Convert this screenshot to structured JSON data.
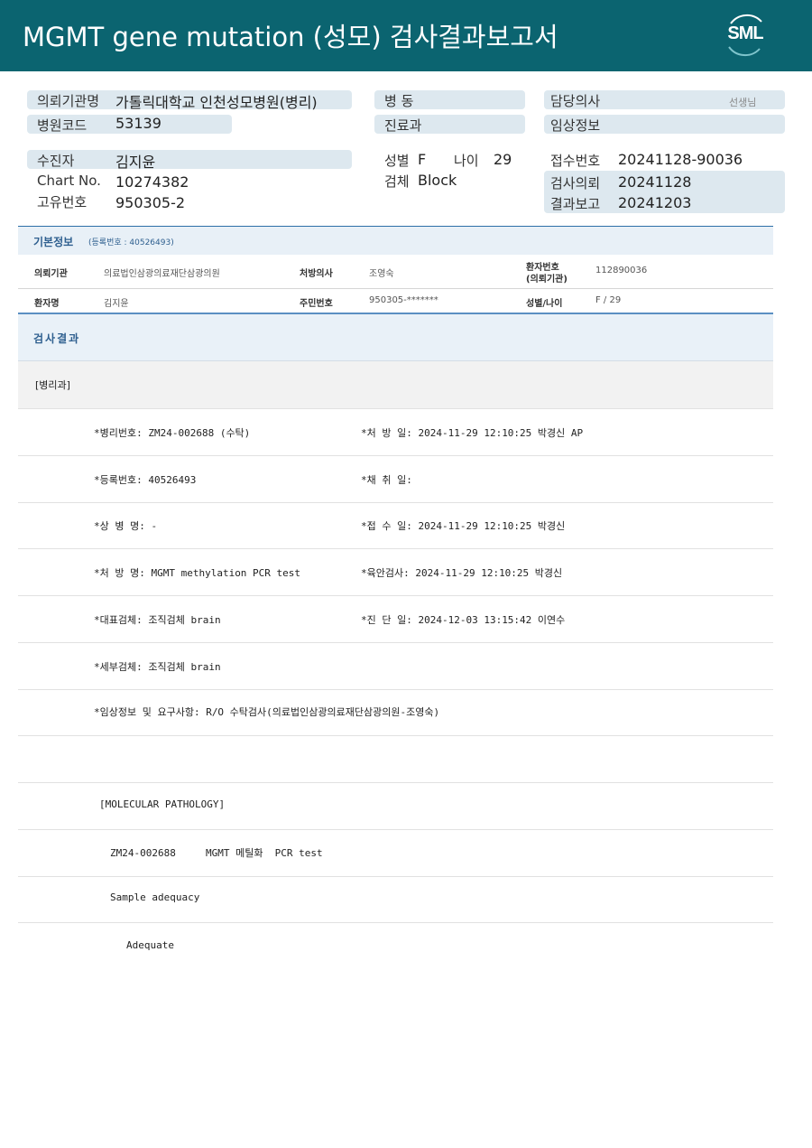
{
  "header": {
    "title": "MGMT gene mutation (성모) 검사결과보고서",
    "logo_text": "SML"
  },
  "top_info": {
    "hospital_label": "의뢰기관명",
    "hospital_value": "가톨릭대학교 인천성모병원(병리)",
    "code_label": "병원코드",
    "code_value": "53139",
    "ward_label": "병  동",
    "dept_label": "진료과",
    "doctor_label": "담당의사",
    "doctor_suffix": "선생님",
    "clinical_label": "임상정보",
    "patient_label": "수진자",
    "patient_value": "김지윤",
    "chart_label": "Chart No.",
    "chart_value": "10274382",
    "id_label": "고유번호",
    "id_value": "950305-2",
    "sex_label": "성별",
    "sex_value": "F",
    "age_label": "나이",
    "age_value": "29",
    "specimen_label": "검체",
    "specimen_value": "Block",
    "recv_label": "접수번호",
    "recv_value": "20241128-90036",
    "req_label": "검사의뢰",
    "req_value": "20241128",
    "report_label": "결과보고",
    "report_value": "20241203"
  },
  "basic_info": {
    "title": "기본정보",
    "reg_note": "(등록번호 : 40526493)",
    "row1": {
      "l1": "의뢰기관",
      "v1": "의료법인삼광의료재단삼광의원",
      "l2": "처방의사",
      "v2": "조영숙",
      "l3a": "환자번호",
      "l3b": "(의뢰기관)",
      "v3": "112890036"
    },
    "row2": {
      "l1": "환자명",
      "v1": "김지윤",
      "l2": "주민번호",
      "v2": "950305-*******",
      "l3": "성별/나이",
      "v3": "F / 29"
    }
  },
  "results": {
    "title": "검사결과",
    "dept": "[병리과]",
    "rows": [
      {
        "left": "*병리번호: ZM24-002688 (수탁)",
        "right": "*처 방 일: 2024-11-29 12:10:25  박경신 AP"
      },
      {
        "left": "*등록번호: 40526493",
        "right": "*채 취 일:"
      },
      {
        "left": "*상 병 명: -",
        "right": "*접 수 일: 2024-11-29 12:10:25  박경신"
      },
      {
        "left": "*처 방 명: MGMT methylation  PCR test",
        "right": "*육안검사: 2024-11-29 12:10:25  박경신"
      },
      {
        "left": "*대표검체: 조직검체 brain",
        "right": "*진 단 일: 2024-12-03 13:15:42  이연수"
      },
      {
        "left": "*세부검체: 조직검체 brain",
        "right": ""
      },
      {
        "left": "*임상정보 및 요구사항: R/O 수탁검사(의료법인삼광의료재단삼광의원-조영숙)",
        "right": ""
      }
    ],
    "molecular_header": "[MOLECULAR PATHOLOGY]",
    "molecular_line": "ZM24-002688     MGMT 메틸화  PCR test",
    "sample_label": "Sample adequacy",
    "sample_value": "Adequate"
  }
}
